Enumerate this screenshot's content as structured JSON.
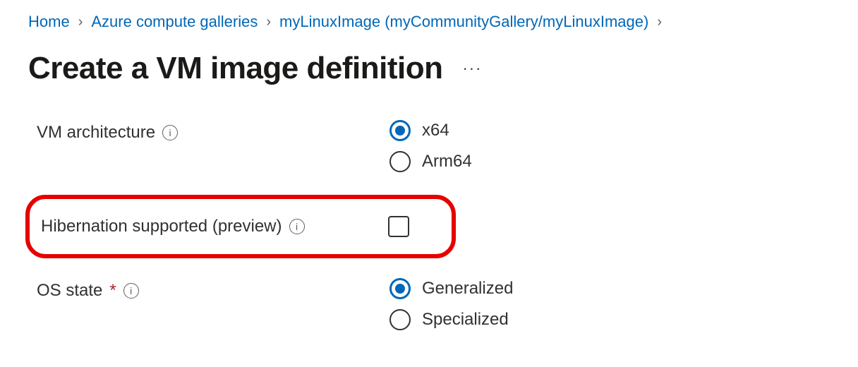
{
  "breadcrumb": {
    "home": "Home",
    "galleries": "Azure compute galleries",
    "image": "myLinuxImage (myCommunityGallery/myLinuxImage)"
  },
  "page_title": "Create a VM image definition",
  "more": "···",
  "fields": {
    "vm_arch": {
      "label": "VM architecture",
      "options": {
        "x64": "x64",
        "arm64": "Arm64"
      },
      "selected": "x64"
    },
    "hibernation": {
      "label": "Hibernation supported (preview)",
      "checked": false
    },
    "os_state": {
      "label": "OS state",
      "options": {
        "generalized": "Generalized",
        "specialized": "Specialized"
      },
      "selected": "generalized"
    }
  },
  "info_glyph": "i",
  "required_mark": "*",
  "chevron": "›"
}
